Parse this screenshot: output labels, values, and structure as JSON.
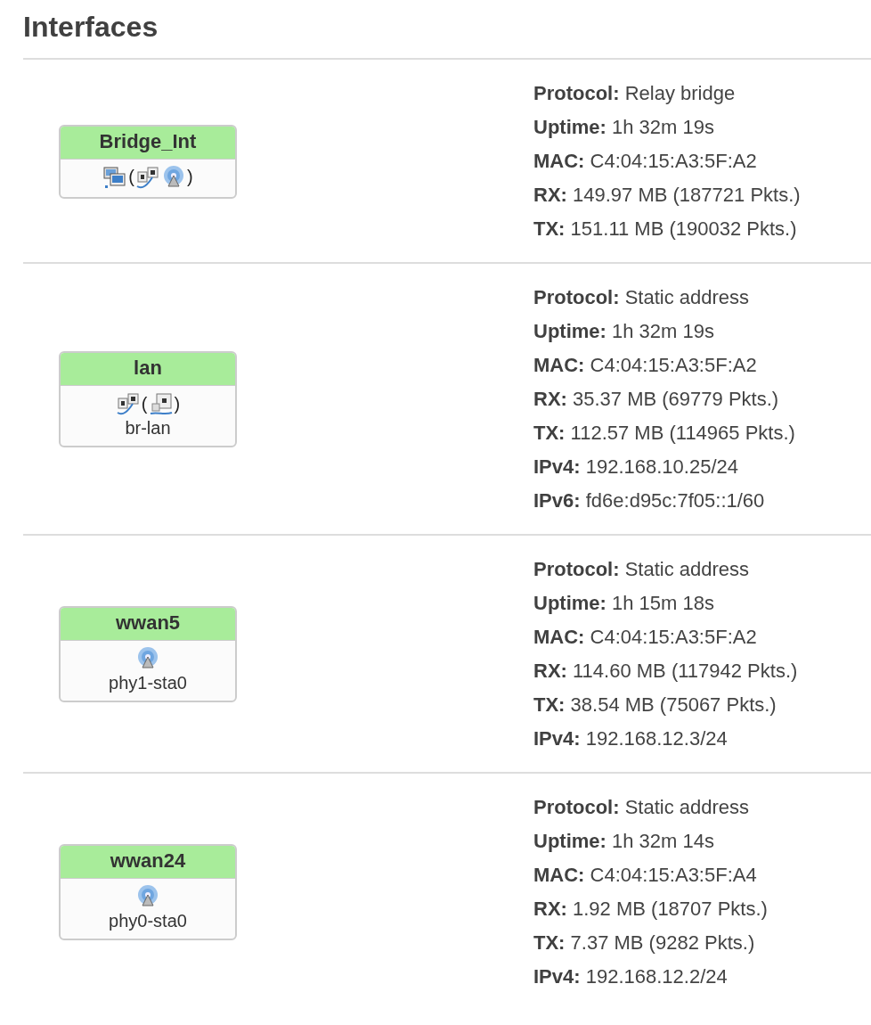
{
  "title": "Interfaces",
  "interfaces": [
    {
      "name": "Bridge_Int",
      "devices": [
        {
          "kind": "bridge"
        },
        {
          "kind": "paren",
          "text": "("
        },
        {
          "kind": "ethernet"
        },
        {
          "kind": "wifi"
        },
        {
          "kind": "paren",
          "text": ")"
        }
      ],
      "details": [
        {
          "label": "Protocol:",
          "value": "Relay bridge"
        },
        {
          "label": "Uptime:",
          "value": "1h 32m 19s"
        },
        {
          "label": "MAC:",
          "value": "C4:04:15:A3:5F:A2"
        },
        {
          "label": "RX:",
          "value": "149.97 MB (187721 Pkts.)"
        },
        {
          "label": "TX:",
          "value": "151.11 MB (190032 Pkts.)"
        }
      ]
    },
    {
      "name": "lan",
      "devices": [
        {
          "kind": "ethernet"
        },
        {
          "kind": "paren",
          "text": "("
        },
        {
          "kind": "port"
        },
        {
          "kind": "paren",
          "text": ")"
        }
      ],
      "device": "br-lan",
      "details": [
        {
          "label": "Protocol:",
          "value": "Static address"
        },
        {
          "label": "Uptime:",
          "value": "1h 32m 19s"
        },
        {
          "label": "MAC:",
          "value": "C4:04:15:A3:5F:A2"
        },
        {
          "label": "RX:",
          "value": "35.37 MB (69779 Pkts.)"
        },
        {
          "label": "TX:",
          "value": "112.57 MB (114965 Pkts.)"
        },
        {
          "label": "IPv4:",
          "value": "192.168.10.25/24"
        },
        {
          "label": "IPv6:",
          "value": "fd6e:d95c:7f05::1/60"
        }
      ]
    },
    {
      "name": "wwan5",
      "devices": [
        {
          "kind": "wifi"
        }
      ],
      "device": "phy1-sta0",
      "details": [
        {
          "label": "Protocol:",
          "value": "Static address"
        },
        {
          "label": "Uptime:",
          "value": "1h 15m 18s"
        },
        {
          "label": "MAC:",
          "value": "C4:04:15:A3:5F:A2"
        },
        {
          "label": "RX:",
          "value": "114.60 MB (117942 Pkts.)"
        },
        {
          "label": "TX:",
          "value": "38.54 MB (75067 Pkts.)"
        },
        {
          "label": "IPv4:",
          "value": "192.168.12.3/24"
        }
      ]
    },
    {
      "name": "wwan24",
      "devices": [
        {
          "kind": "wifi"
        }
      ],
      "device": "phy0-sta0",
      "details": [
        {
          "label": "Protocol:",
          "value": "Static address"
        },
        {
          "label": "Uptime:",
          "value": "1h 32m 14s"
        },
        {
          "label": "MAC:",
          "value": "C4:04:15:A3:5F:A4"
        },
        {
          "label": "RX:",
          "value": "1.92 MB (18707 Pkts.)"
        },
        {
          "label": "TX:",
          "value": "7.37 MB (9282 Pkts.)"
        },
        {
          "label": "IPv4:",
          "value": "192.168.12.2/24"
        }
      ]
    }
  ]
}
